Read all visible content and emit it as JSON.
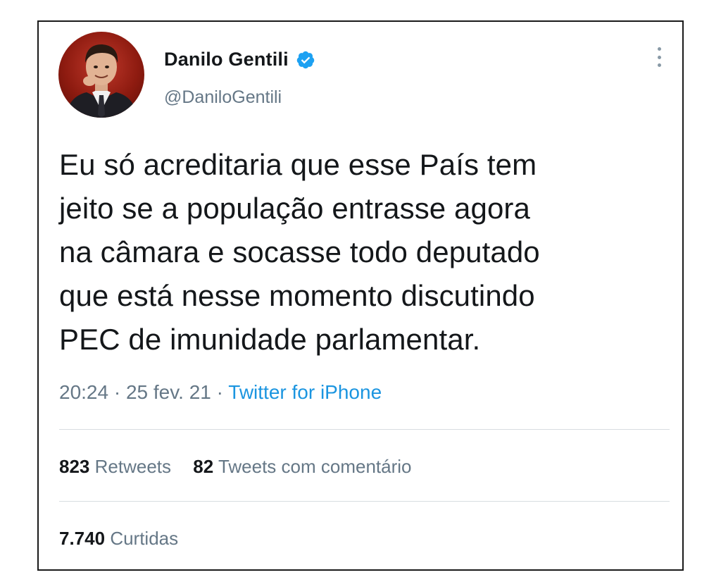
{
  "author": {
    "display_name": "Danilo Gentili",
    "handle": "@DaniloGentili",
    "verified": true,
    "avatar_icon": "profile-photo"
  },
  "tweet": {
    "text": "Eu só acreditaria que esse País tem\njeito se a população entrasse agora\nna câmara e socasse todo deputado\nque está nesse momento discutindo\nPEC de imunidade parlamentar.",
    "time": "20:24",
    "date": "25 fev. 21",
    "separator": "·",
    "source": "Twitter for iPhone"
  },
  "stats": {
    "retweets_count": "823",
    "retweets_label": "Retweets",
    "quotes_count": "82",
    "quotes_label": "Tweets com comentário",
    "likes_count": "7.740",
    "likes_label": "Curtidas"
  },
  "colors": {
    "text": "#14171a",
    "secondary": "#657786",
    "link": "#1b95e0",
    "verified": "#1da1f2"
  },
  "icons": {
    "more": "more-vertical-icon",
    "verified": "verified-badge-icon"
  }
}
